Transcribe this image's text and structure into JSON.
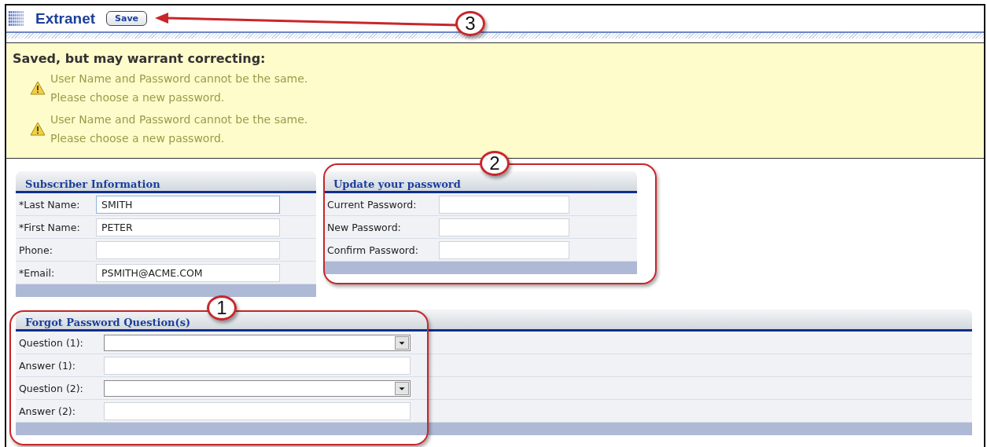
{
  "header": {
    "title": "Extranet",
    "save_button": "Save"
  },
  "message": {
    "heading": "Saved, but may warrant correcting:",
    "items": [
      {
        "lines": [
          "User Name and Password cannot be the same.",
          "Please choose a new password."
        ]
      },
      {
        "lines": [
          "User Name and Password cannot be the same.",
          "Please choose a new password."
        ]
      }
    ]
  },
  "sections": [
    {
      "title": "Subscriber Information",
      "fields": [
        {
          "label": "*Last Name:",
          "kind": "text",
          "value": "SMITH",
          "focused": true
        },
        {
          "label": "*First Name:",
          "kind": "text",
          "value": "PETER",
          "focused": false
        },
        {
          "label": "Phone:",
          "kind": "text",
          "focused": false
        },
        {
          "label": "*Email:",
          "kind": "text",
          "value": "PSMITH@ACME.COM",
          "focused": false
        }
      ]
    },
    {
      "title": "Update your password",
      "fields": [
        {
          "label": "Current Password:",
          "kind": "text",
          "focused": false
        },
        {
          "label": "New Password:",
          "kind": "text",
          "focused": false
        },
        {
          "label": "Confirm Password:",
          "kind": "text",
          "focused": false
        }
      ]
    },
    {
      "title": "Forgot Password Question(s)",
      "fields": [
        {
          "label": "Question (1):",
          "kind": "select",
          "focused": false
        },
        {
          "label": "Answer (1):",
          "kind": "text",
          "focused": false
        },
        {
          "label": "Question (2):",
          "kind": "select",
          "focused": false
        },
        {
          "label": "Answer (2):",
          "kind": "text",
          "focused": false
        }
      ]
    }
  ],
  "annotations": [
    {
      "label": "3"
    },
    {
      "label": "2"
    },
    {
      "label": "1"
    }
  ]
}
